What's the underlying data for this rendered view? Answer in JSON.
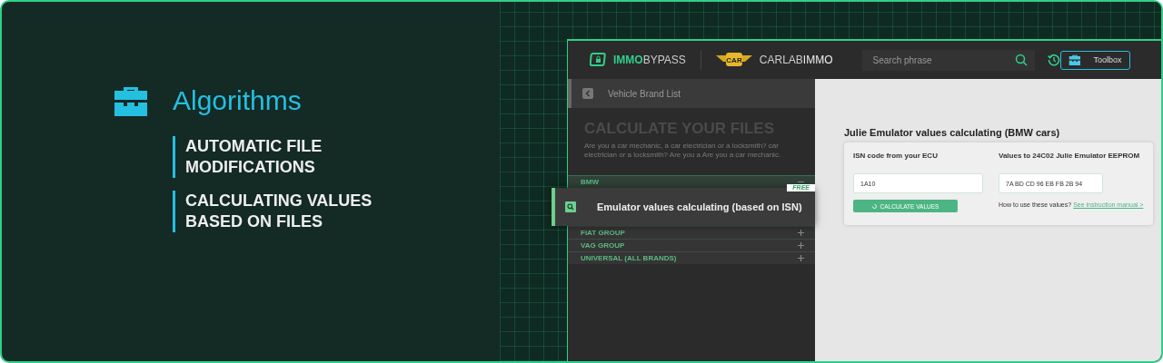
{
  "hero": {
    "title": "Algorithms",
    "features": [
      "AUTOMATIC FILE MODIFICATIONS",
      "CALCULATING VALUES BASED ON FILES"
    ]
  },
  "header": {
    "logo_left": {
      "strong": "IMMO",
      "light": "BYPASS"
    },
    "logo_right": {
      "light": "CARLAB",
      "strong": "IMMO",
      "badge": "CAR"
    },
    "search": {
      "placeholder": "Search phrase"
    },
    "toolbox_button": "Toolbox"
  },
  "sidebar": {
    "back_label": "Vehicle Brand List",
    "title": "CALCULATE YOUR FILES",
    "description": "Are you a car mechanic, a car electrician or a locksmith? car electrician or a locksmith? Are you a Are you a car mechanic.",
    "brands": [
      {
        "label": "BMW",
        "expanded": true,
        "children": [
          {
            "label": "Emulator values calculating (based on ISN)",
            "badge": "FREE",
            "selected": true
          }
        ]
      },
      {
        "label": "FIAT GROUP",
        "expanded": false
      },
      {
        "label": "VAG GROUP",
        "expanded": false
      },
      {
        "label": "UNIVERSAL (ALL BRANDS)",
        "expanded": false
      }
    ]
  },
  "content": {
    "title": "Julie Emulator values calculating (BMW cars)",
    "isn_label": "ISN code from your ECU",
    "isn_value": "1A10",
    "result_label": "Values to 24C02 Julie Emulator EEPROM",
    "result_value": "7A BD CD 96 EB FB 2B 94",
    "calculate_button": "CALCULATE VALUES",
    "help_text": "How to use these values?",
    "help_link": "See instruction manual >"
  }
}
